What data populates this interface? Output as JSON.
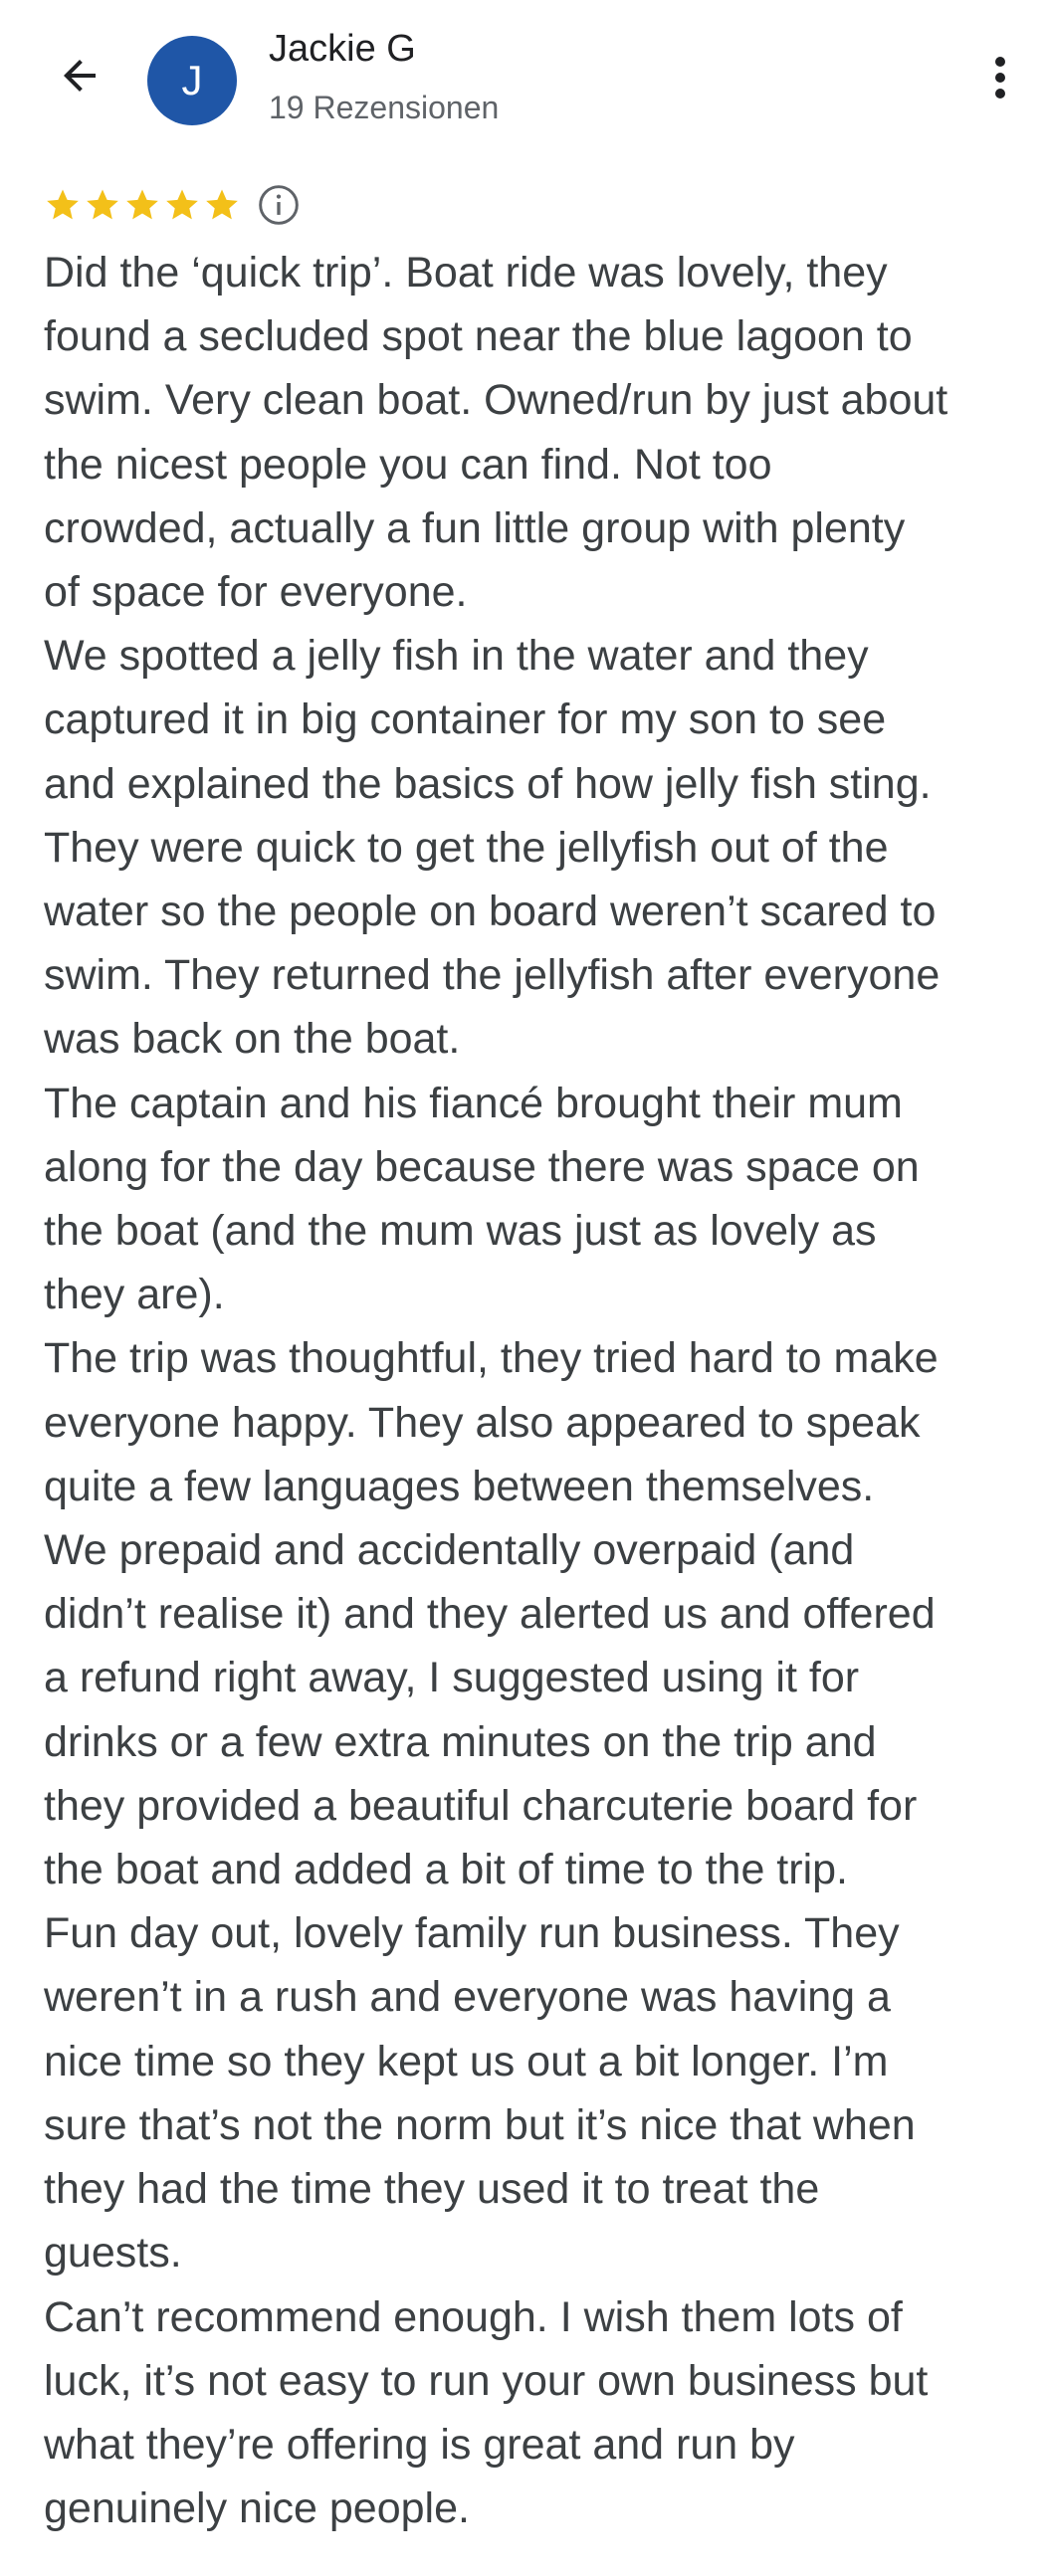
{
  "header": {
    "reviewer_name": "Jackie G",
    "reviewer_initial": "J",
    "reviewer_subtitle": "19 Rezensionen",
    "back_icon": "arrow-back-icon",
    "more_icon": "more-vert-icon",
    "avatar_color": "#1f56a7"
  },
  "rating": {
    "stars": 5,
    "max_stars": 5,
    "star_color": "#f3c019",
    "info_icon": "info-icon"
  },
  "review": {
    "paragraphs": [
      "Did the ‘quick trip’. Boat ride was lovely, they\nfound a secluded spot near the blue lagoon to\nswim. Very clean boat. Owned/run by just about\nthe nicest people you can find. Not too\ncrowded, actually a fun little group with plenty\nof space for everyone.",
      "We spotted a jelly fish in the water and they\ncaptured it in big container for my son to see\nand explained the basics of how jelly fish sting.\nThey were quick to get the jellyfish out of the\nwater so the people on board weren’t scared to\nswim. They returned the jellyfish after everyone\nwas back on the boat.",
      "The captain and his fiancé brought their mum\nalong for the day because there was space on\nthe boat (and the mum was just as lovely as\nthey are).",
      "The trip was thoughtful, they tried hard to make\neveryone happy. They also appeared to speak\nquite a few languages between themselves.",
      "We prepaid and accidentally overpaid (and\ndidn’t realise it) and they alerted us and offered\na refund right away, I suggested using it for\ndrinks or a few extra minutes on the trip and\nthey provided a beautiful charcuterie board for\nthe boat and added a bit of time to the trip.",
      "Fun day out, lovely family run business. They\nweren’t in a rush and everyone was having a\nnice time so they kept us out a bit longer. I’m\nsure that’s not the norm but it’s nice that when\nthey had the time they used it to treat the\nguests.",
      "Can’t recommend enough. I wish them lots of\nluck, it’s not easy to run your own business but\nwhat they’re offering is great and run by\ngenuinely nice people."
    ]
  }
}
